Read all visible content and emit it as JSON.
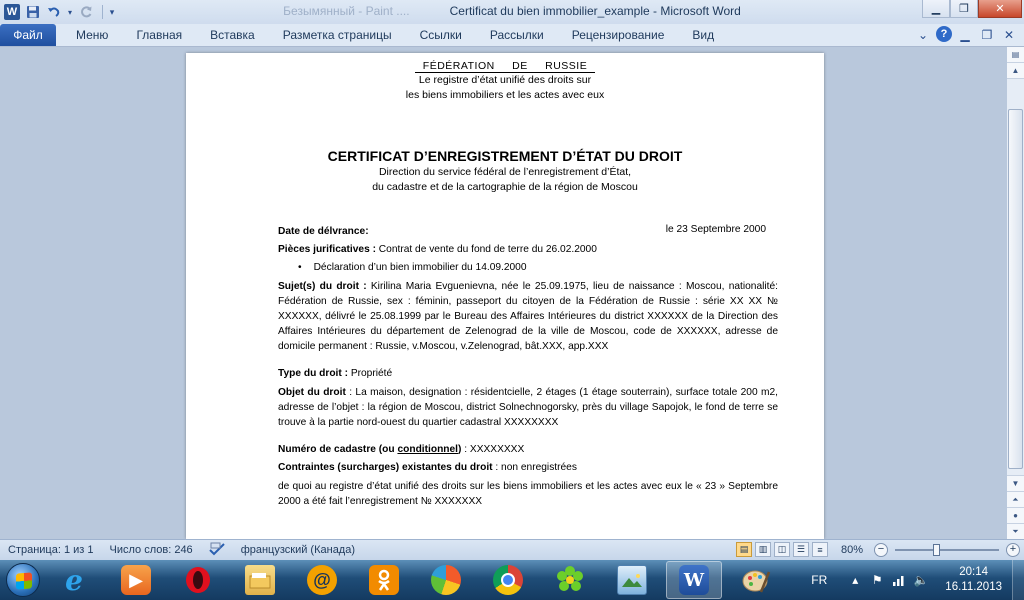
{
  "window": {
    "title": "Certificat du bien immobilier_example  -  Microsoft Word",
    "ghost_title": "Безымянный - Paint  ...."
  },
  "qat": {
    "word_logo": "W",
    "save_icon": "floppy-icon",
    "undo_icon": "undo-icon",
    "redo_icon": "redo-icon"
  },
  "ribbon": {
    "file_tab": "Файл",
    "tabs": [
      "Меню",
      "Главная",
      "Вставка",
      "Разметка страницы",
      "Ссылки",
      "Рассылки",
      "Рецензирование",
      "Вид"
    ]
  },
  "document": {
    "header_line1": "FÉDÉRATION DE RUSSIE",
    "header_line2": "Le registre d’état unifié des droits sur",
    "header_line3": "les biens immobiliers et les actes avec eux",
    "cert_title": "CERTIFICAT D’ENREGISTREMENT D’ÉTAT DU DROIT",
    "direction_line1": "Direction du service fédéral de l’enregistrement d’État,",
    "direction_line2": "du cadastre et de la cartographie de la région de Moscou",
    "date_label": "Date de délvrance:",
    "date_value": "le 23 Septembre 2000",
    "pieces_label": "Pièces jurificatives :",
    "pieces_value": " Contrat de vente du fond de terre du 26.02.2000",
    "bullet_item": "Déclaration d’un bien immobilier du 14.09.2000",
    "sujets_label": "Sujet(s) du droit :",
    "sujets_value": " Kirilina Maria Evguenievna, née le 25.09.1975, lieu de naissance : Moscou, nationalité: Fédération de Russie, sex : féminin, passeport du citoyen de la Fédération de Russie : série XX XX № XXXXXX, délivré le 25.08.1999 par le Bureau des Affaires Intérieures du district XXXXXX de la Direction des Affaires Intérieures du département de Zelenograd de la ville de Moscou, code de XXXXXX, adresse de domicile permanent : Russie, v.Moscou, v.Zelenograd, bât.XXX, app.XXX",
    "type_label": "Type du droit :",
    "type_value": " Propriété",
    "objet_label": "Objet du droit",
    "objet_value": " : La maison, designation : résidentcielle, 2 étages (1 étage souterrain), surface totale 200 m2, adresse de l’objet : la région de Moscou, district Solnechnogorsky, près du village Sapojok, le fond de terre se trouve à la partie nord-ouest du quartier cadastral XXXXXXXX",
    "cadastre_label_a": "Numéro de cadastre (ou ",
    "cadastre_label_u": "conditionnel",
    "cadastre_label_b": ")",
    "cadastre_value": " : XXXXXXXX",
    "contraintes_label": "Contraintes (surcharges) existantes du droit",
    "contraintes_value": " : non enregistrées",
    "final_paragraph": "de quoi au registre d’état unifié des droits sur les biens immobiliers et les actes avec eux le « 23 » Septembre 2000 a été fait l’enregistrement № XXXXXXX"
  },
  "statusbar": {
    "page": "Страница: 1 из 1",
    "words": "Число слов: 246",
    "language": "французский (Канада)",
    "zoom": "80%",
    "zoom_level_percent": 80
  },
  "taskbar": {
    "language": "FR",
    "time": "20:14",
    "date": "16.11.2013"
  }
}
